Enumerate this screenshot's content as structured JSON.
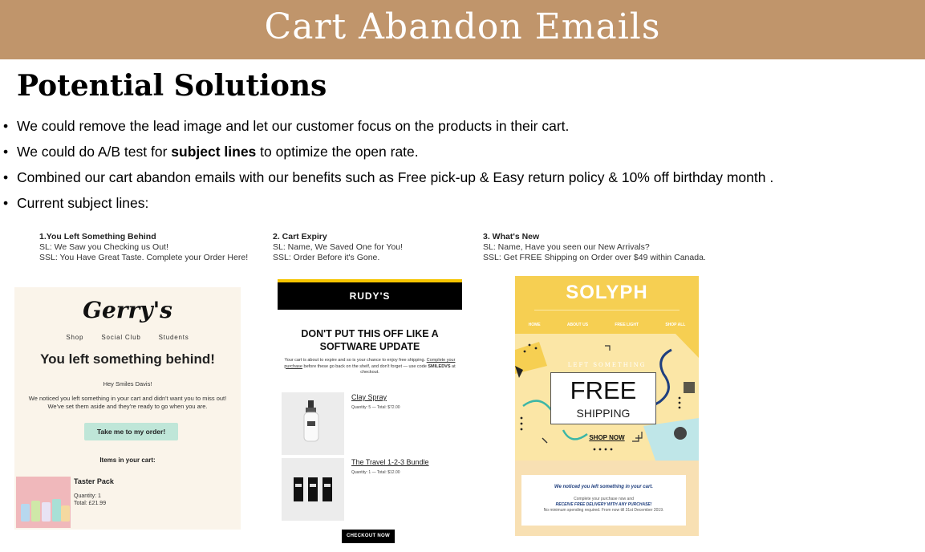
{
  "banner": {
    "title": "Cart Abandon Emails"
  },
  "heading": "Potential Solutions",
  "bullets": [
    {
      "before": "We could remove the lead image and let our customer focus on the products in their cart.",
      "bold": "",
      "after": ""
    },
    {
      "before": "We could do A/B test for ",
      "bold": "subject lines",
      "after": " to optimize the open rate."
    },
    {
      "before": "Combined our cart abandon emails with our benefits such as Free pick-up & Easy return policy & 10% off birthday month .",
      "bold": "",
      "after": ""
    },
    {
      "before": "Current subject lines:",
      "bold": "",
      "after": ""
    }
  ],
  "columns": [
    {
      "title": "1.You Left Something Behind",
      "sl": "SL: We Saw you Checking us Out!",
      "ssl": "SSL: You Have Great Taste. Complete your Order Here!"
    },
    {
      "title": "2. Cart Expiry",
      "sl": "SL: Name, We Saved One for You!",
      "ssl": "SSL: Order Before it's Gone."
    },
    {
      "title": "3. What's New",
      "sl": "SL: Name, Have you seen our New Arrivals?",
      "ssl": "SSL: Get FREE Shipping on Order over $49 within Canada."
    }
  ],
  "email1": {
    "logo": "Gerry's",
    "nav": [
      "Shop",
      "Social Club",
      "Students"
    ],
    "headline": "You left something behind!",
    "greeting": "Hey Smiles Davis!",
    "body": "We noticed you left something in your cart and didn't want you to miss out! We've set them aside and they're ready to go when you are.",
    "button": "Take me to my order!",
    "items_heading": "Items in your cart:",
    "item": {
      "name": "Taster Pack",
      "quantity": "Quantity: 1",
      "total": "Total: £21.99"
    }
  },
  "email2": {
    "logo": "RUDY'S",
    "headline": "DON'T PUT THIS OFF LIKE A SOFTWARE UPDATE",
    "body_start": "Your cart is about to expire and so is your chance to enjoy free shipping. ",
    "body_link": "Complete your purchase",
    "body_mid": " before these go back on the shelf, and don't forget — use code ",
    "body_code": "SMILEDVS",
    "body_end": " at checkout.",
    "products": [
      {
        "name": "Clay Spray",
        "detail": "Quantity: 5 — Total: $72.00"
      },
      {
        "name": "The Travel 1-2-3 Bundle",
        "detail": "Quantity: 1 — Total: $12.00"
      }
    ],
    "button": "CHECKOUT NOW"
  },
  "email3": {
    "logo": "SOLYPH",
    "nav": [
      "HOME",
      "ABOUT US",
      "FREE LIGHT",
      "SHOP ALL"
    ],
    "left_something": "LEFT SOMETHING",
    "free": "FREE",
    "shipping": "SHIPPING",
    "shop_now": "SHOP NOW",
    "notice": "We noticed you left something in your cart.",
    "complete": "Complete your purchase now and",
    "receive": "RECEIVE FREE DELIVERY WITH ANY PURCHASE!",
    "fine_print": "No minimum spending required. From now till 31st December 2019."
  },
  "colors": {
    "banner": "#c0956b",
    "rudys_bar": "#000000",
    "rudys_stripe": "#f5c400",
    "solyph_yellow": "#f6cf52",
    "gerrys_button": "#bfe6d8"
  }
}
